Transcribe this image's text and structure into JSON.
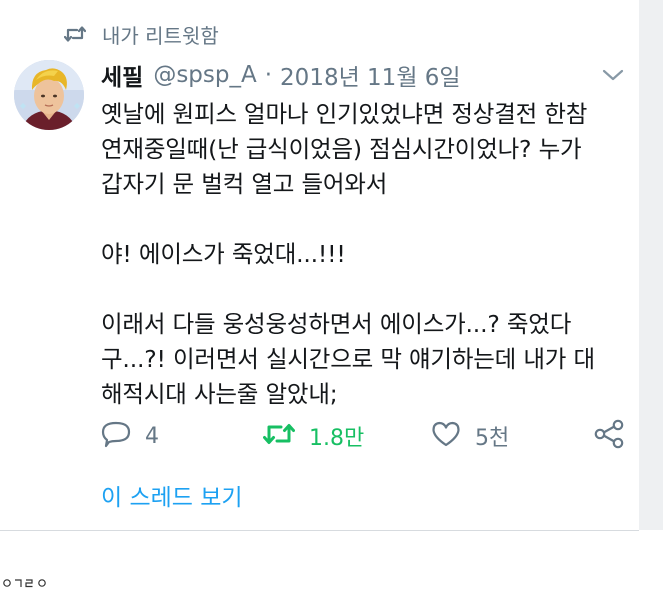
{
  "retweet_header": {
    "label": "내가 리트윗함",
    "icon": "retweet-icon"
  },
  "tweet": {
    "author_name": "세필",
    "handle": "@spsp_A",
    "separator": "·",
    "date": "2018년 11월 6일",
    "menu_icon": "chevron-down-icon",
    "lines": [
      "옛날에 원피스 얼마나 인기있었냐면 정상결전 한참",
      "연재중일때(난 급식이었음) 점심시간이었나? 누가",
      "갑자기 문 벌컥 열고 들어와서",
      "",
      "야! 에이스가 죽었대...!!!",
      "",
      "이래서 다들 웅성웅성하면서 에이스가...? 죽었다",
      "구...?! 이러면서 실시간으로 막 얘기하는데 내가 대",
      "해적시대 사는줄 알았내;"
    ]
  },
  "actions": {
    "reply_count": "4",
    "retweet_count": "1.8만",
    "like_count": "5천",
    "retweet_active_color": "#17bf63",
    "muted_color": "#657786"
  },
  "thread_link": "이 스레드 보기",
  "watermark": "ㅇㄱㄹㅇ",
  "colors": {
    "link": "#1da1f2",
    "text": "#14171a"
  }
}
